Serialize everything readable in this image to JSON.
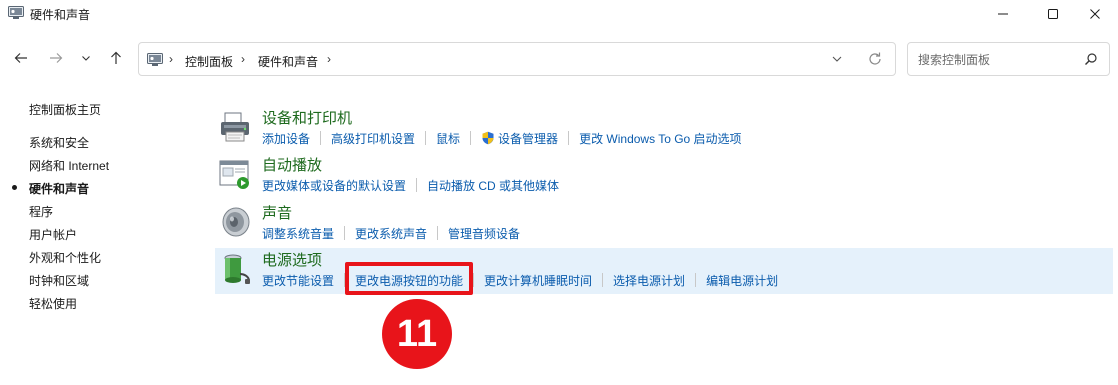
{
  "window": {
    "title": "硬件和声音",
    "controls": {
      "minimize": "minimize-icon",
      "maximize": "maximize-icon",
      "close": "close-icon"
    }
  },
  "address": {
    "crumbs": [
      "控制面板",
      "硬件和声音"
    ],
    "separator": "›"
  },
  "search": {
    "placeholder": "搜索控制面板"
  },
  "sidebar": {
    "items": [
      {
        "label": "控制面板主页",
        "current": false
      },
      {
        "label": "系统和安全",
        "current": false
      },
      {
        "label": "网络和 Internet",
        "current": false
      },
      {
        "label": "硬件和声音",
        "current": true
      },
      {
        "label": "程序",
        "current": false
      },
      {
        "label": "用户帐户",
        "current": false
      },
      {
        "label": "外观和个性化",
        "current": false
      },
      {
        "label": "时钟和区域",
        "current": false
      },
      {
        "label": "轻松使用",
        "current": false
      }
    ]
  },
  "categories": [
    {
      "heading": "设备和打印机",
      "icon": "printer-icon",
      "links": [
        "添加设备",
        "高级打印机设置",
        "鼠标",
        "设备管理器",
        "更改 Windows To Go 启动选项"
      ]
    },
    {
      "heading": "自动播放",
      "icon": "autoplay-icon",
      "links": [
        "更改媒体或设备的默认设置",
        "自动播放 CD 或其他媒体"
      ]
    },
    {
      "heading": "声音",
      "icon": "speaker-icon",
      "links": [
        "调整系统音量",
        "更改系统声音",
        "管理音频设备"
      ]
    },
    {
      "heading": "电源选项",
      "icon": "battery-icon",
      "links": [
        "更改节能设置",
        "更改电源按钮的功能",
        "更改计算机睡眠时间",
        "选择电源计划",
        "编辑电源计划"
      ]
    }
  ],
  "annotation": {
    "badge": "11"
  },
  "colors": {
    "heading": "#1e6a1e",
    "link": "#0b5cad",
    "selected_bg": "#e5f1fb",
    "highlight": "#e8141a"
  }
}
